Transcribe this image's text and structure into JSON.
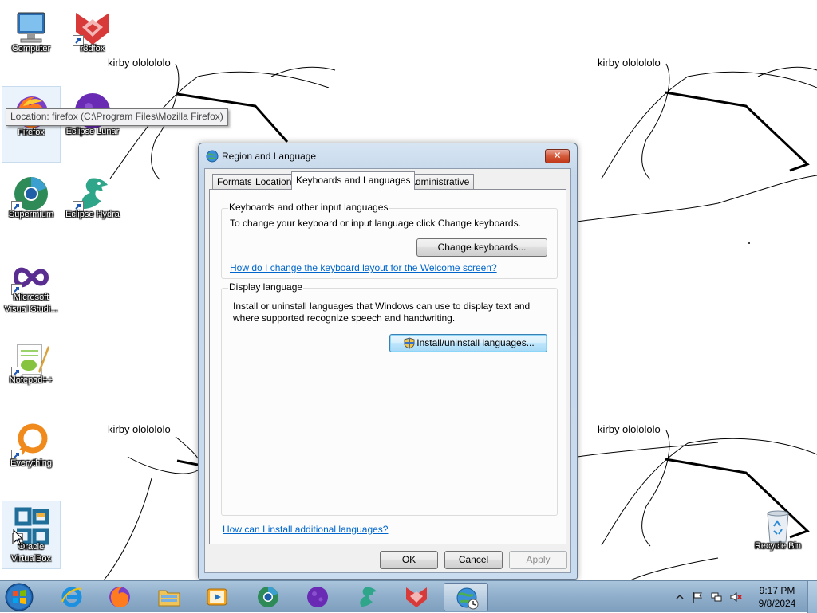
{
  "wallpaper": {
    "captions": [
      "kirby ololololo",
      "kirby ololololo",
      "kirby ololololo",
      "kirby ololololo"
    ]
  },
  "desktop_icons": [
    {
      "label": "Computer",
      "icon": "computer-icon"
    },
    {
      "label": "r3dfox",
      "icon": "r3dfox-icon"
    },
    {
      "label": "Firefox",
      "icon": "firefox-icon"
    },
    {
      "label": "Eclipse Lunar",
      "icon": "eclipse-lunar-icon"
    },
    {
      "label": "Supermium",
      "icon": "supermium-icon"
    },
    {
      "label": "Eclipse Hydra",
      "icon": "eclipse-hydra-icon"
    },
    {
      "label": "Microsoft Visual Studi...",
      "icon": "visual-studio-icon"
    },
    {
      "label": "Notepad++",
      "icon": "notepad-plus-plus-icon"
    },
    {
      "label": "Everything",
      "icon": "everything-icon"
    },
    {
      "label": "Oracle VirtualBox",
      "icon": "virtualbox-icon"
    },
    {
      "label": "Recycle Bin",
      "icon": "recycle-bin-icon"
    }
  ],
  "tooltip": "Location: firefox (C:\\Program Files\\Mozilla Firefox)",
  "dialog": {
    "title": "Region and Language",
    "tabs": [
      "Formats",
      "Location",
      "Keyboards and Languages",
      "Administrative"
    ],
    "active_tab": "Keyboards and Languages",
    "keyboards_group": {
      "title": "Keyboards and other input languages",
      "description": "To change your keyboard or input language click Change keyboards.",
      "button": "Change keyboards...",
      "link": "How do I change the keyboard layout for the Welcome screen?"
    },
    "display_group": {
      "title": "Display language",
      "description": "Install or uninstall languages that Windows can use to display text and where supported recognize speech and handwriting.",
      "button": "Install/uninstall languages..."
    },
    "bottom_link": "How can I install additional languages?",
    "ok": "OK",
    "cancel": "Cancel",
    "apply": "Apply"
  },
  "taskbar": {
    "items": [
      "internet-explorer-icon",
      "firefox-icon",
      "file-explorer-icon",
      "media-player-icon",
      "supermium-icon",
      "eclipse-lunar-icon",
      "eclipse-hydra-icon",
      "r3dfox-icon",
      "region-language-icon"
    ],
    "active_item": "region-language-icon",
    "time": "9:17 PM",
    "date": "9/8/2024"
  },
  "colors": {
    "link": "#0066cc",
    "taskbar": "#8faecb",
    "close_button": "#d45a3a"
  }
}
